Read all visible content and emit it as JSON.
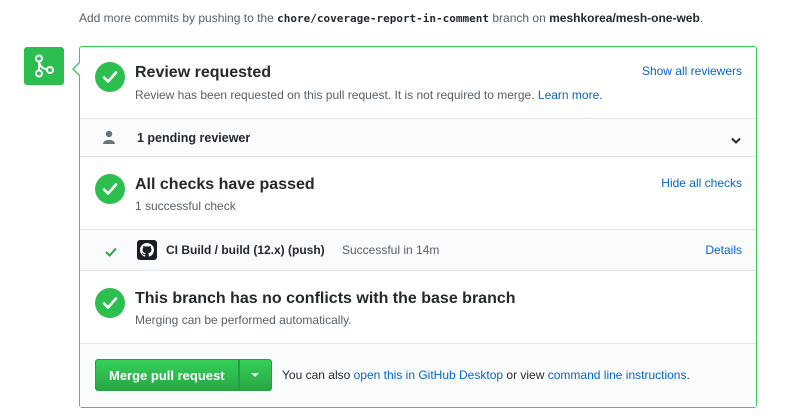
{
  "header": {
    "prefix": "Add more commits by pushing to the",
    "branch": "chore/coverage-report-in-comment",
    "middle": "branch on",
    "repo": "meshkorea/mesh-one-web",
    "suffix": "."
  },
  "review": {
    "title": "Review requested",
    "desc": "Review has been requested on this pull request. It is not required to merge.",
    "learn_more": "Learn more.",
    "show_all": "Show all reviewers"
  },
  "pending": {
    "label": "1 pending reviewer"
  },
  "checks": {
    "title": "All checks have passed",
    "subtitle": "1 successful check",
    "hide_all": "Hide all checks",
    "item": {
      "name": "CI Build / build (12.x) (push)",
      "status": "Successful in 14m",
      "details": "Details"
    }
  },
  "conflicts": {
    "title": "This branch has no conflicts with the base branch",
    "subtitle": "Merging can be performed automatically."
  },
  "merge": {
    "button": "Merge pull request",
    "also": "You can also",
    "desktop_link": "open this in GitHub Desktop",
    "or_view": "or view",
    "cli_link": "command line instructions",
    "end": "."
  },
  "colors": {
    "success": "#2cbe4e",
    "link": "#0366d6",
    "border": "#34d058"
  },
  "icons": [
    "git-merge-icon",
    "check-circle-icon",
    "person-icon",
    "chevron-down-icon",
    "check-icon",
    "github-logo-icon",
    "dropdown-caret-icon"
  ]
}
